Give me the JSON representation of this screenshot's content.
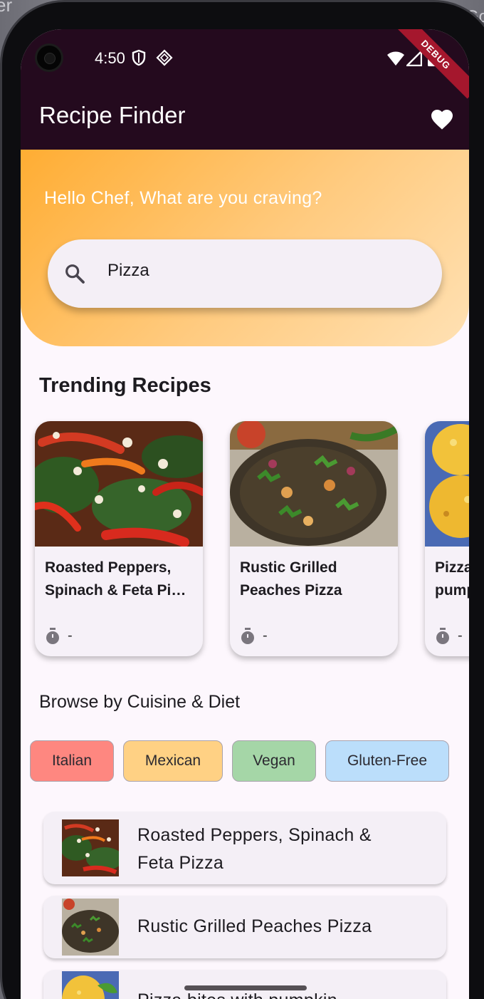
{
  "desktop": {
    "left_fragment": "er",
    "right_fragment": "Go"
  },
  "status_bar": {
    "time": "4:50",
    "debug_label": "DEBUG"
  },
  "app_bar": {
    "title": "Recipe Finder"
  },
  "hero": {
    "greeting": "Hello Chef, What are you craving?",
    "search": {
      "value": "Pizza",
      "placeholder": ""
    }
  },
  "trending": {
    "title": "Trending Recipes",
    "cards": [
      {
        "name_line1": "Roasted Peppers,",
        "name_line2": "Spinach & Feta Pi…",
        "time": "-"
      },
      {
        "name_line1": "Rustic Grilled",
        "name_line2": "Peaches Pizza",
        "time": "-"
      },
      {
        "name_line1": "Pizza",
        "name_line2": "pump",
        "time": "-"
      }
    ]
  },
  "browse": {
    "title": "Browse by Cuisine & Diet",
    "chips": [
      {
        "label": "Italian",
        "color": "#fe8780"
      },
      {
        "label": "Mexican",
        "color": "#ffd184"
      },
      {
        "label": "Vegan",
        "color": "#a5d6a7"
      },
      {
        "label": "Gluten-Free",
        "color": "#bbdefb"
      }
    ]
  },
  "recipe_list": [
    {
      "line1": "Roasted Peppers, Spinach &",
      "line2": "Feta Pizza"
    },
    {
      "line1": "Rustic Grilled Peaches Pizza",
      "line2": ""
    },
    {
      "line1": "Pizza bites with pumpkin",
      "line2": ""
    }
  ],
  "colors": {
    "app_bar": "#240a1e",
    "hero_start": "#ffad33",
    "hero_end": "#ffe1b4",
    "surface": "#fdf7fd",
    "card": "#f6f1f8"
  }
}
